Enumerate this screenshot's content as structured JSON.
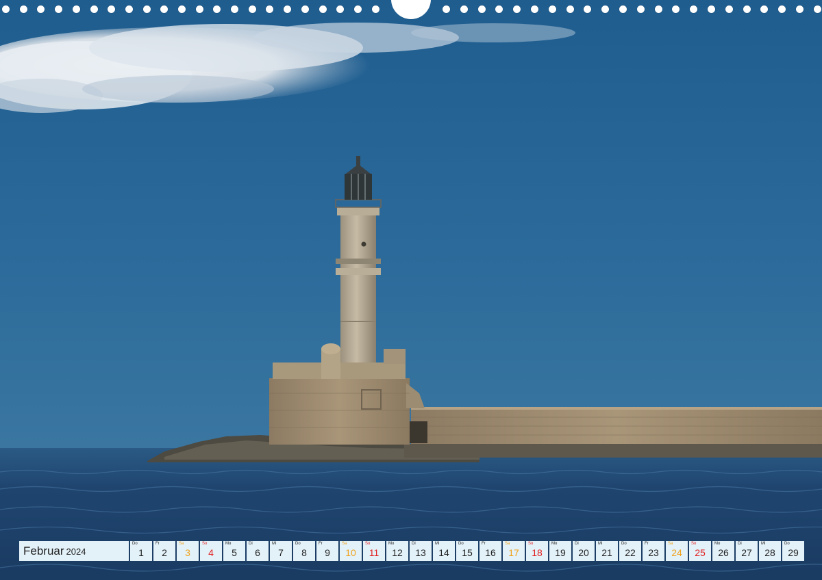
{
  "calendar": {
    "month": "Februar",
    "year": "2024",
    "days": [
      {
        "wd": "Do",
        "num": "1",
        "type": "weekday"
      },
      {
        "wd": "Fr",
        "num": "2",
        "type": "weekday"
      },
      {
        "wd": "Sa",
        "num": "3",
        "type": "sat"
      },
      {
        "wd": "So",
        "num": "4",
        "type": "sun"
      },
      {
        "wd": "Mo",
        "num": "5",
        "type": "weekday"
      },
      {
        "wd": "Di",
        "num": "6",
        "type": "weekday"
      },
      {
        "wd": "Mi",
        "num": "7",
        "type": "weekday"
      },
      {
        "wd": "Do",
        "num": "8",
        "type": "weekday"
      },
      {
        "wd": "Fr",
        "num": "9",
        "type": "weekday"
      },
      {
        "wd": "Sa",
        "num": "10",
        "type": "sat"
      },
      {
        "wd": "So",
        "num": "11",
        "type": "sun"
      },
      {
        "wd": "Mo",
        "num": "12",
        "type": "weekday"
      },
      {
        "wd": "Di",
        "num": "13",
        "type": "weekday"
      },
      {
        "wd": "Mi",
        "num": "14",
        "type": "weekday"
      },
      {
        "wd": "Do",
        "num": "15",
        "type": "weekday"
      },
      {
        "wd": "Fr",
        "num": "16",
        "type": "weekday"
      },
      {
        "wd": "Sa",
        "num": "17",
        "type": "sat"
      },
      {
        "wd": "So",
        "num": "18",
        "type": "sun"
      },
      {
        "wd": "Mo",
        "num": "19",
        "type": "weekday"
      },
      {
        "wd": "Di",
        "num": "20",
        "type": "weekday"
      },
      {
        "wd": "Mi",
        "num": "21",
        "type": "weekday"
      },
      {
        "wd": "Do",
        "num": "22",
        "type": "weekday"
      },
      {
        "wd": "Fr",
        "num": "23",
        "type": "weekday"
      },
      {
        "wd": "Sa",
        "num": "24",
        "type": "sat"
      },
      {
        "wd": "So",
        "num": "25",
        "type": "sun"
      },
      {
        "wd": "Mo",
        "num": "26",
        "type": "weekday"
      },
      {
        "wd": "Di",
        "num": "27",
        "type": "weekday"
      },
      {
        "wd": "Mi",
        "num": "28",
        "type": "weekday"
      },
      {
        "wd": "Do",
        "num": "29",
        "type": "weekday"
      }
    ]
  },
  "colors": {
    "sky": "#2b6a9a",
    "sea": "#1d3f66",
    "stone": "#a08d70",
    "saturday": "#f0a21a",
    "sunday": "#e11f1f",
    "calendar_bg": "#e3f1f8"
  }
}
